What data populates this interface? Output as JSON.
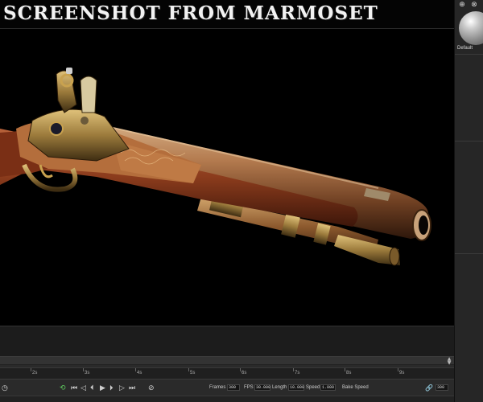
{
  "viewport": {
    "title": "SCREENSHOT FROM MARMOSET"
  },
  "right_panel": {
    "add_icon": "plus-icon",
    "close_icon": "close-icon",
    "material_name": "Default"
  },
  "timeline": {
    "ruler_ticks": [
      "2s",
      "3s",
      "4s",
      "5s",
      "6s",
      "7s",
      "8s",
      "9s"
    ],
    "frames_label": "Frames",
    "frames_value": "300",
    "fps_label": "FPS",
    "fps_value": "30.000",
    "length_label": "Length",
    "length_value": "10.000",
    "speed_label": "Speed",
    "speed_value": "1.000",
    "bake_speed_label": "Bake Speed",
    "end_frame_value": "300"
  },
  "colors": {
    "viewport_bg": "#000000",
    "panel_bg": "#262626",
    "accent_green": "#5ec85e"
  }
}
